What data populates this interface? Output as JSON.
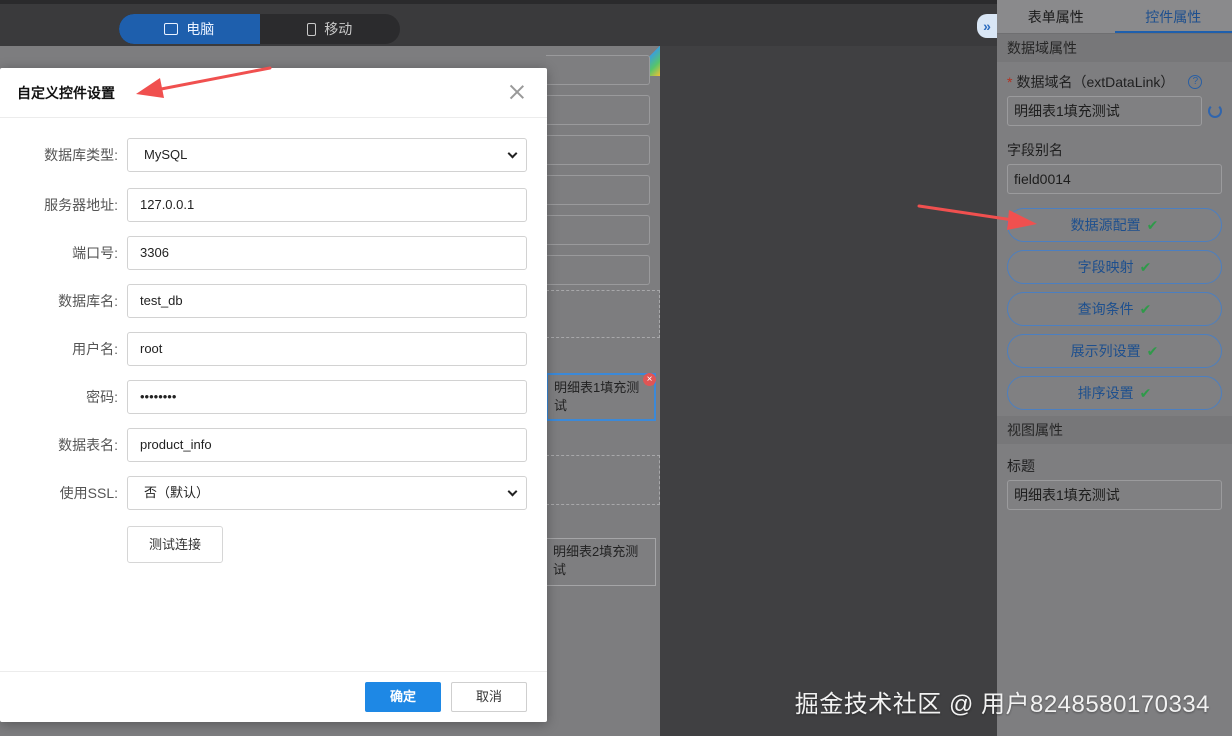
{
  "device_toggle": {
    "desktop_label": "电脑",
    "mobile_label": "移动"
  },
  "canvas": {
    "cell1_text": "明细表1填充测试",
    "cell2_text": "明细表2填充测试"
  },
  "panel": {
    "collapse_label": "»",
    "tabs": [
      {
        "label": "表单属性"
      },
      {
        "label": "控件属性"
      }
    ],
    "data_section_title": "数据域属性",
    "data_field_label": "数据域名（extDataLink）",
    "required_mark": "*",
    "help_mark": "?",
    "data_field_value": "明细表1填充测试",
    "alias_label": "字段别名",
    "alias_value": "field0014",
    "config_buttons": [
      {
        "label": "数据源配置"
      },
      {
        "label": "字段映射"
      },
      {
        "label": "查询条件"
      },
      {
        "label": "展示列设置"
      },
      {
        "label": "排序设置"
      }
    ],
    "check_mark": "✔",
    "view_section_title": "视图属性",
    "title_label": "标题",
    "title_value": "明细表1填充测试"
  },
  "modal": {
    "title": "自定义控件设置",
    "fields": [
      {
        "label": "数据库类型:",
        "value": "MySQL"
      },
      {
        "label": "服务器地址:",
        "value": "127.0.0.1"
      },
      {
        "label": "端口号:",
        "value": "3306"
      },
      {
        "label": "数据库名:",
        "value": "test_db"
      },
      {
        "label": "用户名:",
        "value": "root"
      },
      {
        "label": "密码:",
        "value": "••••••••"
      },
      {
        "label": "数据表名:",
        "value": "product_info"
      },
      {
        "label": "使用SSL:",
        "value": "否（默认）"
      }
    ],
    "test_button": "测试连接",
    "ok_button": "确定",
    "cancel_button": "取消"
  },
  "watermark": "掘金技术社区 @ 用户8248580170334",
  "colors": {
    "accent": "#1e88e5",
    "annotation_arrow": "#f0504f",
    "check": "#2f9a4a"
  }
}
